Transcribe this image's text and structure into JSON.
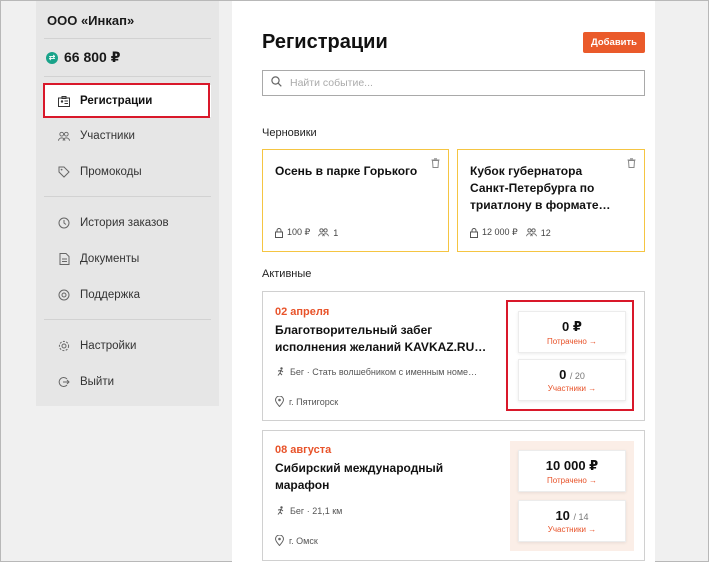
{
  "sidebar": {
    "org_name": "ООО «Инкап»",
    "balance": "66 800 ₽",
    "items": [
      {
        "label": "Регистрации",
        "icon": "id-card-icon"
      },
      {
        "label": "Участники",
        "icon": "users-icon"
      },
      {
        "label": "Промокоды",
        "icon": "tag-icon"
      },
      {
        "label": "История заказов",
        "icon": "history-icon"
      },
      {
        "label": "Документы",
        "icon": "document-icon"
      },
      {
        "label": "Поддержка",
        "icon": "support-icon"
      },
      {
        "label": "Настройки",
        "icon": "gear-icon"
      },
      {
        "label": "Выйти",
        "icon": "logout-icon"
      }
    ]
  },
  "header": {
    "title": "Регистрации",
    "add_label": "Добавить"
  },
  "search": {
    "placeholder": "Найти событие..."
  },
  "drafts": {
    "label": "Черновики",
    "cards": [
      {
        "title": "Осень в парке Горького",
        "price": "100 ₽",
        "participants": "1"
      },
      {
        "title": "Кубок губернатора Санкт-Петербурга по триатлону в формате…",
        "price": "12 000 ₽",
        "participants": "12"
      }
    ]
  },
  "active": {
    "label": "Активные",
    "cards": [
      {
        "date": "02 апреля",
        "title": "Благотворительный забег исполнения желаний KAVKAZ.RU…",
        "distance": "Бег · Стать волшебником с именным номе…",
        "city": "г. Пятигорск",
        "spent": "0 ₽",
        "spent_link": "Потрачено →",
        "participants": "0",
        "participants_total": "/ 20",
        "participants_link": "Участники →"
      },
      {
        "date": "08 августа",
        "title": "Сибирский международный марафон",
        "distance": "Бег · 21,1 км",
        "city": "г. Омск",
        "spent": "10 000 ₽",
        "spent_link": "Потрачено →",
        "participants": "10",
        "participants_total": "/ 14",
        "participants_link": "Участники →"
      }
    ]
  },
  "colors": {
    "accent": "#ea5a2a",
    "highlight": "#d9182a",
    "draft_border": "#f5c542",
    "balance_icon": "#1aa38a"
  }
}
